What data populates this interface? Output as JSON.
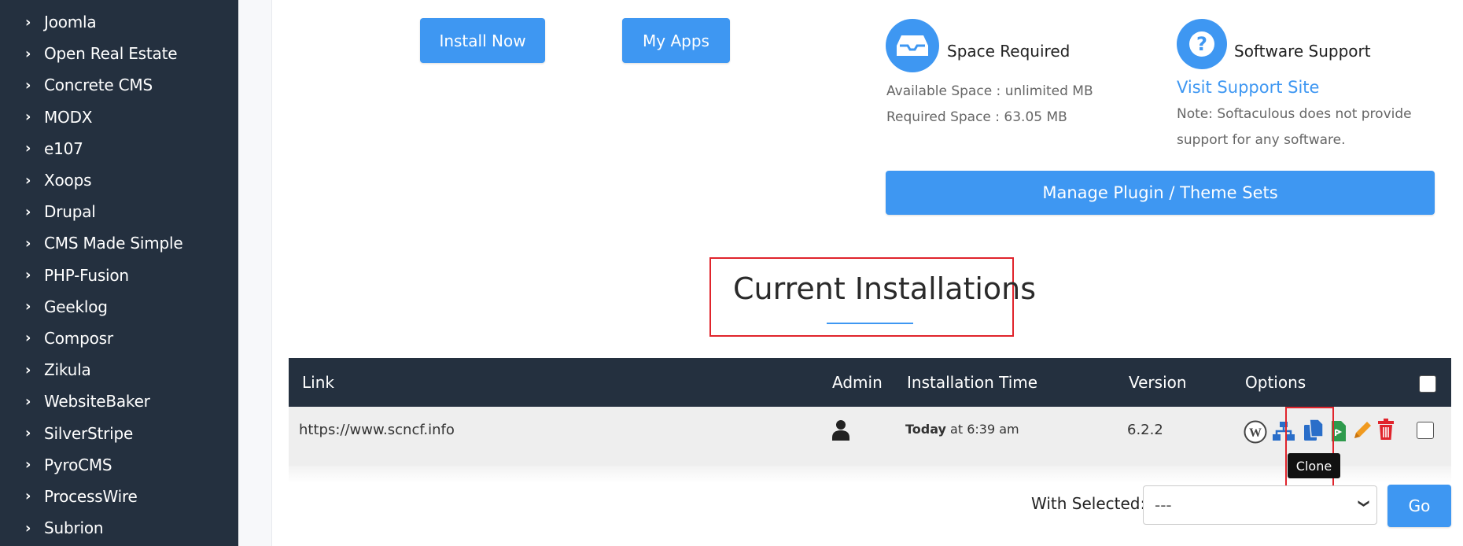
{
  "sidebar": {
    "items": [
      {
        "label": "Joomla"
      },
      {
        "label": "Open Real Estate"
      },
      {
        "label": "Concrete CMS"
      },
      {
        "label": "MODX"
      },
      {
        "label": "e107"
      },
      {
        "label": "Xoops"
      },
      {
        "label": "Drupal"
      },
      {
        "label": "CMS Made Simple"
      },
      {
        "label": "PHP-Fusion"
      },
      {
        "label": "Geeklog"
      },
      {
        "label": "Composr"
      },
      {
        "label": "Zikula"
      },
      {
        "label": "WebsiteBaker"
      },
      {
        "label": "SilverStripe"
      },
      {
        "label": "PyroCMS"
      },
      {
        "label": "ProcessWire"
      },
      {
        "label": "Subrion"
      }
    ]
  },
  "actions": {
    "install_label": "Install Now",
    "myapps_label": "My Apps"
  },
  "space": {
    "title": "Space Required",
    "available": "Available Space : unlimited MB",
    "required": "Required Space : 63.05 MB"
  },
  "support": {
    "title": "Software Support",
    "link": "Visit Support Site",
    "note_line1": "Note: Softaculous does not provide",
    "note_line2": "support for any software."
  },
  "plugin_button": "Manage Plugin / Theme Sets",
  "installations": {
    "title": "Current Installations",
    "headers": {
      "link": "Link",
      "admin": "Admin",
      "time": "Installation Time",
      "version": "Version",
      "options": "Options"
    },
    "rows": [
      {
        "link": "https://www.scncf.info",
        "time_bold": "Today",
        "time_rest": " at 6:39 am",
        "version": "6.2.2"
      }
    ],
    "tooltip": "Clone"
  },
  "bulk": {
    "label": "With Selected:",
    "selected": "---",
    "go": "Go"
  },
  "colors": {
    "accent": "#3e97f2",
    "sidebar": "#24303f",
    "highlight": "#e0242c"
  }
}
